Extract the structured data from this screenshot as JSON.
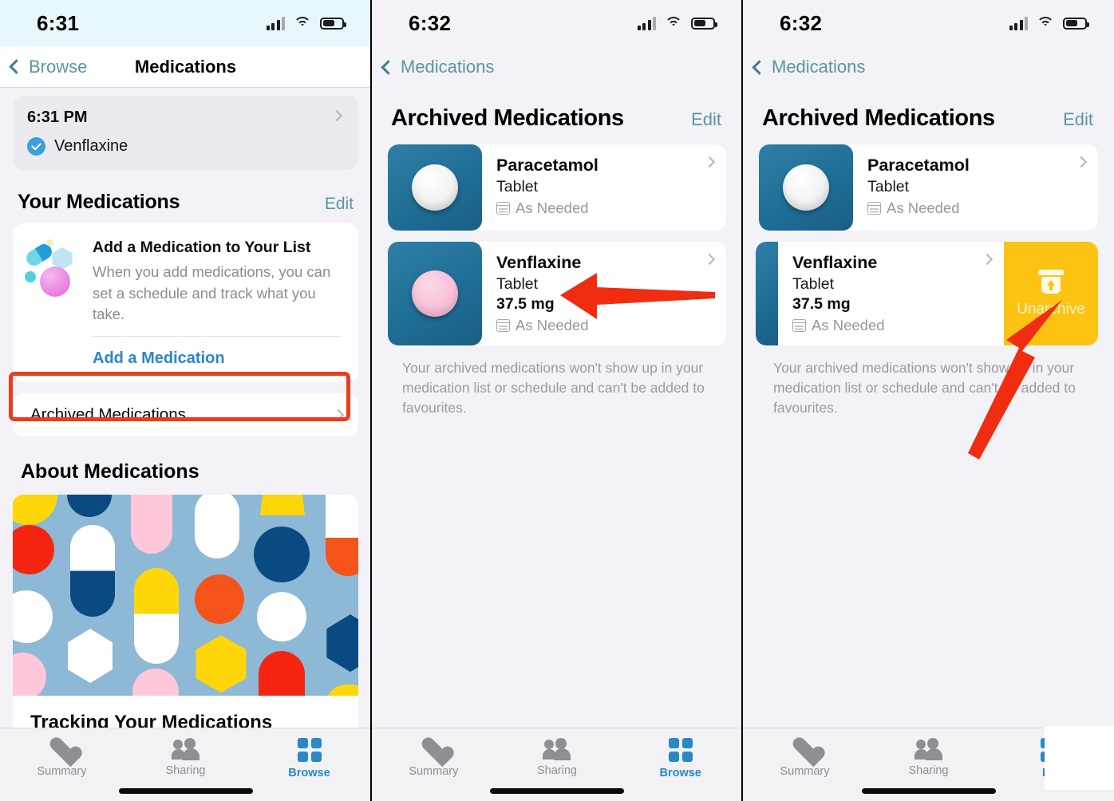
{
  "panels": [
    {
      "id": "medications-screen",
      "status": {
        "time": "6:31"
      },
      "nav": {
        "back_label": "Browse",
        "title": "Medications"
      },
      "log_card": {
        "time": "6:31 PM",
        "medication": "Venflaxine"
      },
      "your_medications": {
        "title": "Your Medications",
        "edit_label": "Edit"
      },
      "add_card": {
        "title": "Add a Medication to Your List",
        "subtitle": "When you add medications, you can set a schedule and track what you take.",
        "link_label": "Add a Medication"
      },
      "archived_row_label": "Archived Medications",
      "about": {
        "title": "About Medications",
        "caption": "Tracking Your Medications"
      },
      "tabs": [
        {
          "label": "Summary",
          "icon": "heart-icon",
          "active": false
        },
        {
          "label": "Sharing",
          "icon": "people-icon",
          "active": false
        },
        {
          "label": "Browse",
          "icon": "grid-icon",
          "active": true
        }
      ]
    },
    {
      "id": "archived-medications-screen",
      "status": {
        "time": "6:32"
      },
      "nav": {
        "back_label": "Medications",
        "title": ""
      },
      "large_title": "Archived Medications",
      "edit_label": "Edit",
      "medications": [
        {
          "name": "Paracetamol",
          "form": "Tablet",
          "dose": "",
          "schedule": "As Needed",
          "pill_color": "white"
        },
        {
          "name": "Venflaxine",
          "form": "Tablet",
          "dose": "37.5 mg",
          "schedule": "As Needed",
          "pill_color": "pink"
        }
      ],
      "footer_note": "Your archived medications won't show up in your medication list or schedule and can't be added to favourites.",
      "tabs": [
        {
          "label": "Summary",
          "icon": "heart-icon",
          "active": false
        },
        {
          "label": "Sharing",
          "icon": "people-icon",
          "active": false
        },
        {
          "label": "Browse",
          "icon": "grid-icon",
          "active": true
        }
      ]
    },
    {
      "id": "archived-medications-swipe-screen",
      "status": {
        "time": "6:32"
      },
      "nav": {
        "back_label": "Medications",
        "title": ""
      },
      "large_title": "Archived Medications",
      "edit_label": "Edit",
      "medications": [
        {
          "name": "Paracetamol",
          "form": "Tablet",
          "dose": "",
          "schedule": "As Needed",
          "pill_color": "white"
        },
        {
          "name": "Venflaxine",
          "form": "Tablet",
          "dose": "37.5 mg",
          "schedule": "As Needed",
          "pill_color": "pink"
        }
      ],
      "swipe_action_label": "Unarchive",
      "footer_note": "Your archived medications won't show up in your medication list or schedule and can't be added to favourites.",
      "tabs": [
        {
          "label": "Summary",
          "icon": "heart-icon",
          "active": false
        },
        {
          "label": "Sharing",
          "icon": "people-icon",
          "active": false
        },
        {
          "label": "Bro",
          "icon": "grid-icon",
          "active": true
        }
      ]
    }
  ],
  "annotations": {
    "highlight_color": "#ef3b1c",
    "arrow_color": "#f02d10",
    "swipe_action_color": "#fcc313"
  }
}
